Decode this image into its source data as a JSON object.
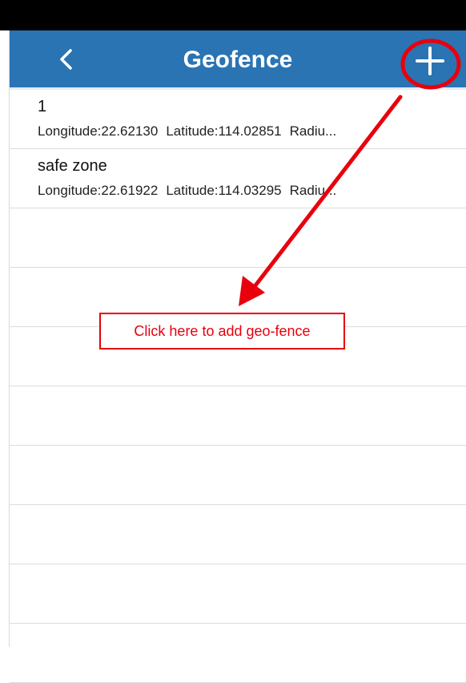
{
  "header": {
    "title": "Geofence",
    "back_icon": "chevron-left-icon",
    "add_icon": "plus-icon"
  },
  "geofences": [
    {
      "name": "1",
      "longitude": "Longitude:22.62130",
      "latitude": "Latitude:114.02851",
      "radius": "Radiu..."
    },
    {
      "name": "safe zone",
      "longitude": "Longitude:22.61922",
      "latitude": "Latitude:114.03295",
      "radius": "Radiu..."
    }
  ],
  "annotation": {
    "text": "Click here to add geo-fence",
    "color": "#e8000d"
  },
  "colors": {
    "header": "#2a74b3",
    "annotation": "#e8000d"
  }
}
